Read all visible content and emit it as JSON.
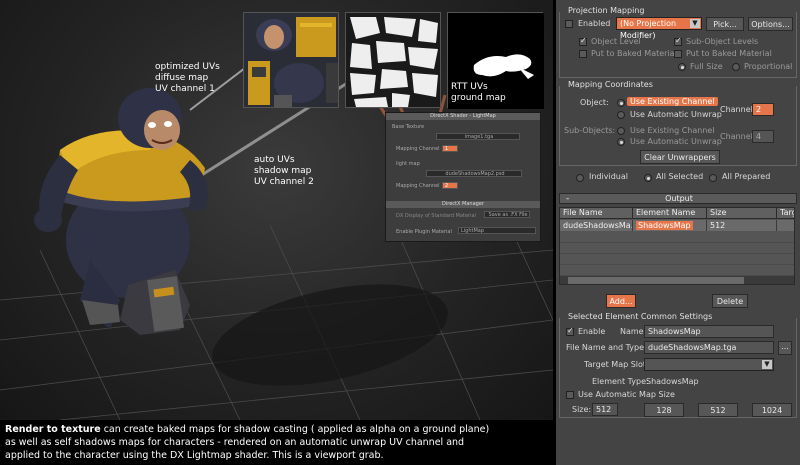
{
  "viewport": {
    "labels": {
      "optimized": [
        "optimized UVs",
        "diffuse map",
        "UV channel 1"
      ],
      "auto": [
        "auto UVs",
        "shadow map",
        "UV channel 2"
      ],
      "rtt": [
        "RTT UVs",
        "ground map"
      ]
    },
    "dx_panel": {
      "title1": "DirectX Shader - LightMap",
      "base_texture": "Base Texture",
      "base_file": "image1.tga",
      "mapping_channel_label": "Mapping Channel",
      "mapping_channel_1": "1",
      "light_map": "light map",
      "light_file": "dudeShadowsMap2.psd",
      "mapping_channel_2": "2",
      "title2": "DirectX Manager",
      "dx_display": "DX Display of Standard Material",
      "save_fx": "Save as .FX File",
      "enable_plugin": "Enable Plugin Material",
      "plugin_value": "LightMap"
    }
  },
  "caption": {
    "bold": "Render to texture",
    "line1": " can create baked maps for shadow casting ( applied as alpha on a ground plane)",
    "line2": "as well as self shadows maps for characters - rendered on an automatic unwrap UV channel and",
    "line3": "applied to the character using the DX Lightmap shader. This is a viewport grab."
  },
  "panel": {
    "projection": {
      "title": "Projection Mapping",
      "enabled": "Enabled",
      "modifier": "(No Projection Modifier)",
      "pick": "Pick...",
      "options": "Options...",
      "object_level": "Object Level",
      "sub_object_levels": "Sub-Object Levels",
      "put_baked_1": "Put to Baked Material",
      "put_baked_2": "Put to Baked Material",
      "full_size": "Full Size",
      "proportional": "Proportional"
    },
    "mapping": {
      "title": "Mapping Coordinates",
      "object": "Object:",
      "use_existing": "Use Existing Channel",
      "use_auto": "Use Automatic Unwrap",
      "channel": "Channel",
      "channel_value": "2",
      "sub_objects": "Sub-Objects:",
      "sub_use_existing": "Use Existing Channel",
      "sub_use_auto": "Use Automatic Unwrap",
      "sub_channel": "Channel",
      "sub_channel_value": "4",
      "clear": "Clear Unwrappers"
    },
    "selection": {
      "individual": "Individual",
      "all_selected": "All Selected",
      "all_prepared": "All Prepared"
    },
    "output": {
      "minus": "-",
      "title": "Output",
      "columns": [
        "File Name",
        "Element Name",
        "Size",
        "Targ"
      ],
      "rows": [
        [
          "dudeShadowsMa...",
          "ShadowsMap",
          "512",
          ""
        ]
      ],
      "add": "Add...",
      "delete": "Delete"
    },
    "element": {
      "title": "Selected Element Common Settings",
      "enable": "Enable",
      "name_label": "Name:",
      "name_value": "ShadowsMap",
      "file_label": "File Name and Type:",
      "file_value": "dudeShadowsMap.tga",
      "file_browse": "...",
      "target_slot": "Target Map Slot:",
      "element_type_label": "Element Type:",
      "element_type_value": "ShadowsMap",
      "use_auto_size": "Use Automatic Map Size",
      "size_label": "Size:",
      "size_value": "512",
      "size_128": "128",
      "size_512": "512",
      "size_1024": "1024"
    }
  }
}
